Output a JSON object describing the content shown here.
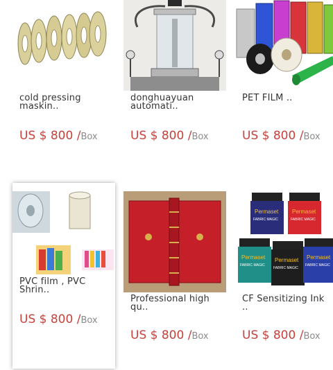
{
  "products": [
    {
      "title": "cold pressing\nmaskin..",
      "price": "US $ 800 /",
      "unit": "Box"
    },
    {
      "title": "donghuayuan\nautomati..",
      "price": "US $ 800 /",
      "unit": "Box"
    },
    {
      "title": "PET FILM ..",
      "price": "US $ 800 /",
      "unit": "Box"
    },
    {
      "title": "PVC film , PVC\nShrin..",
      "price": "US $ 800 /",
      "unit": "Box"
    },
    {
      "title": "Professional high\nqu..",
      "price": "US $ 800 /",
      "unit": "Box"
    },
    {
      "title": "CF Sensitizing Ink\n..",
      "price": "US $ 800 /",
      "unit": "Box"
    }
  ],
  "thumb_labels": {
    "permaset_brand": "Permaset",
    "permaset_sub": "FABRIC MAGIC"
  }
}
